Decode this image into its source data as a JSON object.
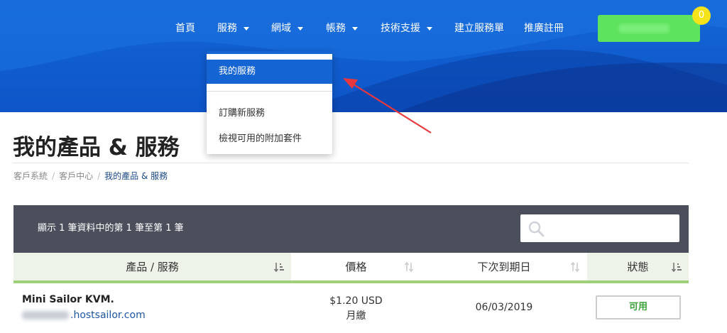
{
  "nav": {
    "items": [
      {
        "label": "首頁",
        "dropdown": false
      },
      {
        "label": "服務",
        "dropdown": true
      },
      {
        "label": "網域",
        "dropdown": true
      },
      {
        "label": "帳務",
        "dropdown": true
      },
      {
        "label": "技術支援",
        "dropdown": true
      },
      {
        "label": "建立服務單",
        "dropdown": false
      },
      {
        "label": "推廣註冊",
        "dropdown": false
      }
    ],
    "cart_count": "0"
  },
  "dropdown": {
    "items": [
      "我的服務",
      "訂購新服務",
      "檢視可用的附加套件"
    ],
    "active_index": 0
  },
  "page": {
    "title": "我的產品 & 服務"
  },
  "breadcrumb": {
    "items": [
      "客戶系統",
      "客戶中心",
      "我的產品 & 服務"
    ]
  },
  "table": {
    "info": "顯示 1 筆資料中的第 1 筆至第 1 筆",
    "search_placeholder": "",
    "columns": [
      "產品 / 服務",
      "價格",
      "下次到期日",
      "狀態"
    ],
    "rows": [
      {
        "product": "Mini Sailor KVM.",
        "domain_suffix": ".hostsailor.com",
        "price": "$1.20 USD",
        "cycle": "月繳",
        "due_date": "06/03/2019",
        "status": "可用"
      }
    ]
  },
  "colors": {
    "header_blue": "#1466d6",
    "cart_green": "#5ee35e",
    "badge_yellow": "#f4e21b",
    "status_green": "#3aa33a",
    "annotation_red": "#e8383d"
  }
}
